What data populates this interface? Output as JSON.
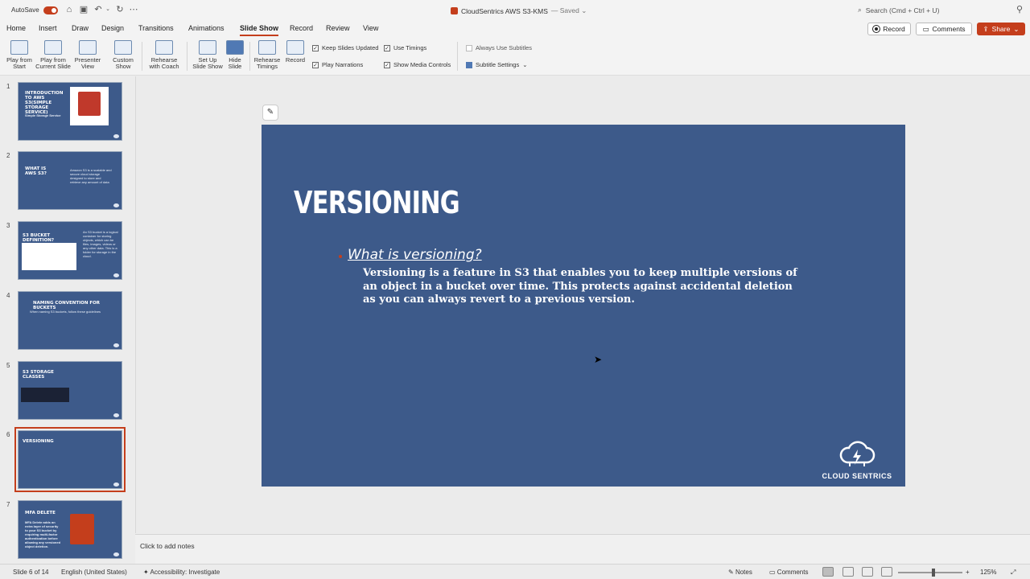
{
  "titlebar": {
    "autosave_label": "AutoSave",
    "doc_title": "CloudSentrics AWS S3-KMS",
    "saved_status": "— Saved ⌄",
    "search_placeholder": "Search (Cmd + Ctrl + U)"
  },
  "tabs": [
    "Home",
    "Insert",
    "Draw",
    "Design",
    "Transitions",
    "Animations",
    "Slide Show",
    "Record",
    "Review",
    "View"
  ],
  "active_tab": "Slide Show",
  "header_buttons": {
    "record": "Record",
    "comments": "Comments",
    "share": "Share"
  },
  "ribbon": {
    "play_from_start": "Play from\nStart",
    "play_from_current": "Play from\nCurrent Slide",
    "presenter_view": "Presenter\nView",
    "custom_show": "Custom\nShow",
    "rehearse_with_coach": "Rehearse\nwith Coach",
    "set_up_slide_show": "Set Up\nSlide Show",
    "hide_slide": "Hide\nSlide",
    "rehearse_timings": "Rehearse\nTimings",
    "record": "Record",
    "keep_slides_updated": "Keep Slides Updated",
    "use_timings": "Use Timings",
    "always_use_subtitles": "Always Use Subtitles",
    "play_narrations": "Play Narrations",
    "show_media_controls": "Show Media Controls",
    "subtitle_settings": "Subtitle Settings"
  },
  "thumbnails": [
    {
      "num": "1",
      "title": "INTRODUCTION TO AWS S3(SIMPLE STORAGE SERVICE)",
      "text": "Simple Storage Service"
    },
    {
      "num": "2",
      "title": "WHAT IS AWS S3?",
      "text": "Amazon S3 is a scalable and secure cloud storage designed to store and retrieve any amount of data"
    },
    {
      "num": "3",
      "title": "S3 BUCKET DEFINITION?",
      "text": "An S3 bucket is a logical container for storing objects, which can be files, images, videos or any other data. This is a folder for storage in the cloud."
    },
    {
      "num": "4",
      "title": "NAMING CONVENTION FOR BUCKETS",
      "text": "When naming S3 buckets, follow these guidelines"
    },
    {
      "num": "5",
      "title": "S3 STORAGE CLASSES",
      "text": ""
    },
    {
      "num": "6",
      "title": "VERSIONING",
      "text": ""
    },
    {
      "num": "7",
      "title": "MFA DELETE",
      "text": "MFA Delete adds an extra layer of security to your S3 bucket by requiring multi-factor authentication before allowing any versioned object deletion."
    }
  ],
  "slide": {
    "title": "VERSIONING",
    "bullet_head": "What is versioning?",
    "body": "Versioning is a feature in S3 that enables you to keep multiple versions of an object in a bucket over time. This protects against accidental deletion as you can always revert to a previous version.",
    "logo_text": "CLOUD SENTRICS"
  },
  "notes_placeholder": "Click to add notes",
  "status": {
    "slide_counter": "Slide 6 of 14",
    "language": "English (United States)",
    "accessibility": "Accessibility: Investigate",
    "notes": "Notes",
    "comments": "Comments",
    "zoom": "125%"
  },
  "colors": {
    "accent": "#c43e1c",
    "slide_bg": "#3d5a8a"
  }
}
